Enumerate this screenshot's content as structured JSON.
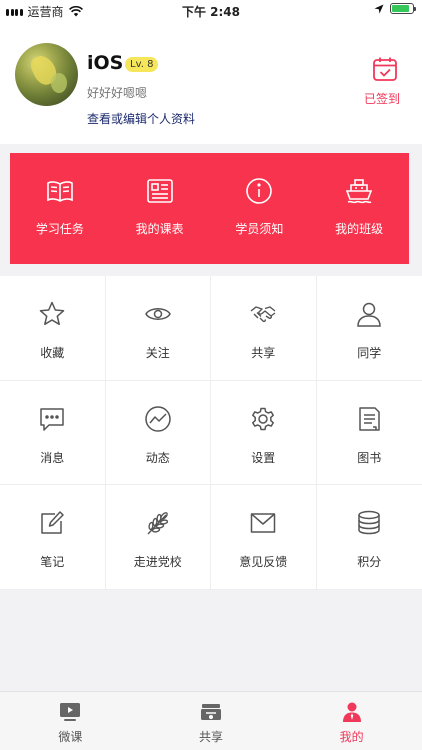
{
  "status_bar": {
    "carrier": "运营商",
    "time": "下午 2:48"
  },
  "profile": {
    "username": "iOS",
    "level": "Lv. 8",
    "signature": "好好好嗯嗯",
    "edit_link": "查看或编辑个人资料",
    "checkin_label": "已签到"
  },
  "red_card": {
    "items": [
      {
        "label": "学习任务",
        "icon": "book-icon"
      },
      {
        "label": "我的课表",
        "icon": "schedule-icon"
      },
      {
        "label": "学员须知",
        "icon": "info-icon"
      },
      {
        "label": "我的班级",
        "icon": "ship-icon"
      }
    ]
  },
  "grid": {
    "items": [
      {
        "label": "收藏",
        "icon": "star-icon"
      },
      {
        "label": "关注",
        "icon": "eye-icon"
      },
      {
        "label": "共享",
        "icon": "handshake-icon"
      },
      {
        "label": "同学",
        "icon": "person-icon"
      },
      {
        "label": "消息",
        "icon": "chat-icon"
      },
      {
        "label": "动态",
        "icon": "trend-icon"
      },
      {
        "label": "设置",
        "icon": "gear-icon"
      },
      {
        "label": "图书",
        "icon": "document-icon"
      },
      {
        "label": "笔记",
        "icon": "note-icon"
      },
      {
        "label": "走进党校",
        "icon": "wheat-icon"
      },
      {
        "label": "意见反馈",
        "icon": "mail-icon"
      },
      {
        "label": "积分",
        "icon": "coins-icon"
      }
    ]
  },
  "tabbar": {
    "items": [
      {
        "label": "微课",
        "icon": "play-icon"
      },
      {
        "label": "共享",
        "icon": "share-box-icon"
      },
      {
        "label": "我的",
        "icon": "user-icon",
        "active": true
      }
    ]
  },
  "colors": {
    "accent": "#f7334d",
    "accent_text": "#f0385a",
    "level_badge": "#f6e65a",
    "link": "#1d2b6e"
  }
}
